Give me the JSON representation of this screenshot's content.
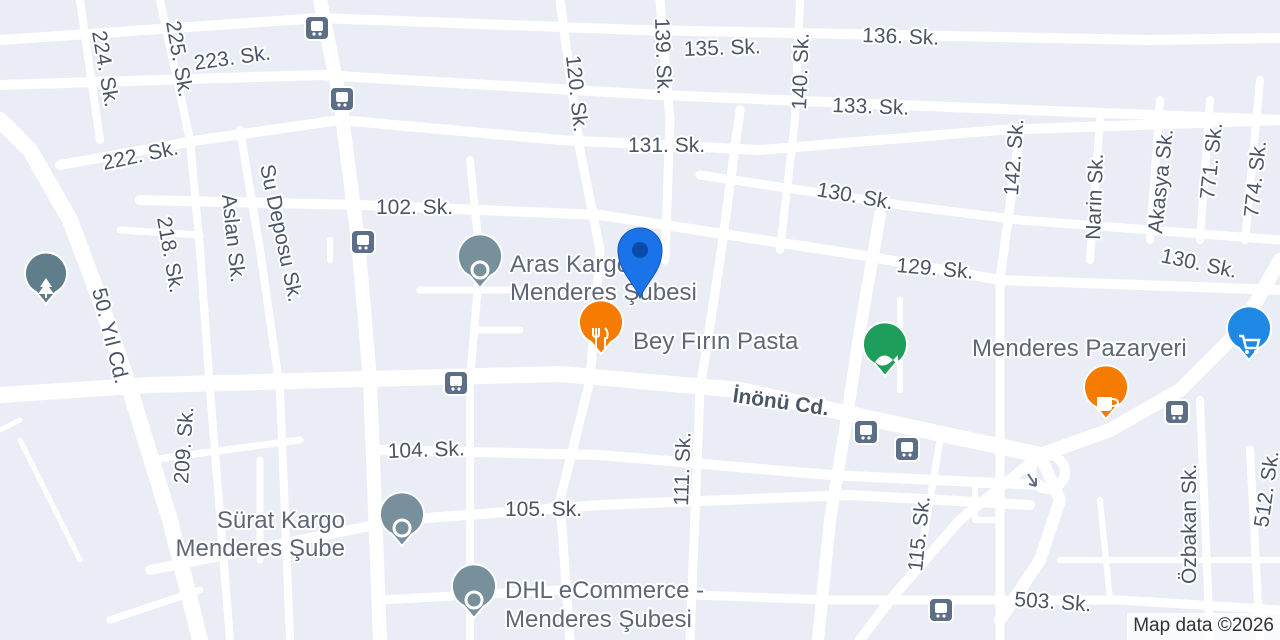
{
  "streets": {
    "s223": "223. Sk.",
    "s224": "224. Sk.",
    "s225": "225. Sk.",
    "s222": "222. Sk.",
    "s218": "218. Sk.",
    "aslan": "Aslan Sk.",
    "sudeposu": "Su Deposu Sk.",
    "s102": "102. Sk.",
    "s120": "120. Sk.",
    "s139": "139. Sk.",
    "s135": "135. Sk.",
    "s140": "140. Sk.",
    "s136": "136. Sk.",
    "s133": "133. Sk.",
    "s131": "131. Sk.",
    "s142": "142. Sk.",
    "narin": "Narin Sk.",
    "akasya": "Akasya Sk.",
    "s771": "771. Sk.",
    "s774": "774. Sk.",
    "s130a": "130. Sk.",
    "s129": "129. Sk.",
    "s130b": "130. Sk.",
    "yil50": "50. Yıl Cd.",
    "inonu": "İnönü Cd.",
    "s104": "104. Sk.",
    "s209": "209. Sk.",
    "s111": "111. Sk.",
    "s105": "105. Sk.",
    "s115": "115. Sk.",
    "ozbakan": "Özbakan Sk.",
    "s512": "512. Sk.",
    "s503": "503. Sk."
  },
  "places": {
    "aras_l1": "Aras Kargo",
    "aras_l2": "Menderes Şubesi",
    "bey": "Bey Fırın Pasta",
    "pazaryeri": "Menderes Pazaryeri",
    "surat_l1": "Sürat Kargo",
    "surat_l2": "Menderes Şube",
    "dhl_l1": "DHL eCommerce -",
    "dhl_l2": "Menderes Şubesi"
  },
  "icons": {
    "bus": "bus-stop-icon",
    "restaurant": "restaurant-icon",
    "cafe": "cafe-icon",
    "shopping": "shopping-cart-icon",
    "park": "park-icon",
    "zoo": "aquarium-icon",
    "generic": "place-icon",
    "pin": "location-pin-icon"
  },
  "colors": {
    "background": "#eaedf5",
    "road": "#ffffff",
    "pin": "#1a73e8",
    "restaurant": "#f57c00",
    "cafe": "#f57c00",
    "shopping": "#1e88e5",
    "park": "#607d8b",
    "zoo": "#1e9e5a",
    "generic_poi": "#78909c",
    "bus": "#5c6f87"
  },
  "attribution": "Map data ©2026"
}
